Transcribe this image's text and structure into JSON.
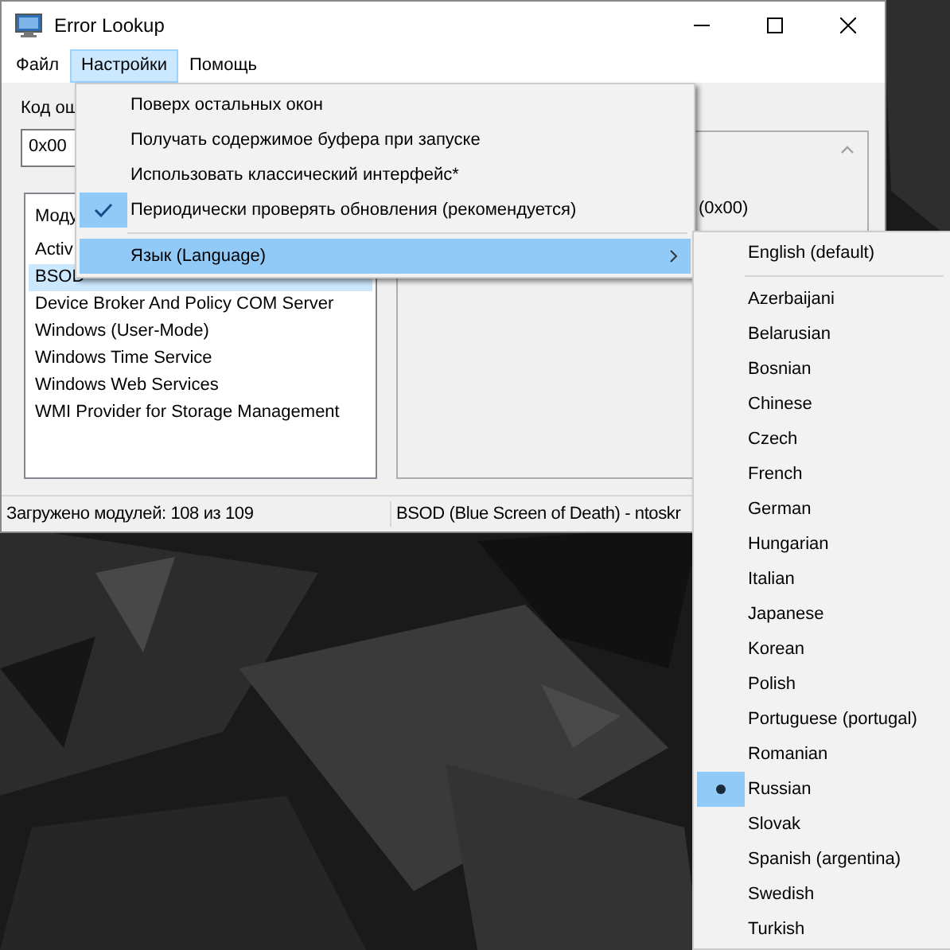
{
  "window": {
    "title": "Error Lookup"
  },
  "menu_bar": [
    {
      "label": "Файл",
      "selected": false
    },
    {
      "label": "Настройки",
      "selected": true
    },
    {
      "label": "Помощь",
      "selected": false
    }
  ],
  "error_code": {
    "label": "Код ош",
    "value": "0x00"
  },
  "modules": {
    "header": "Моду",
    "items": [
      {
        "label": "Activ",
        "selected": false
      },
      {
        "label": "BSOD",
        "selected": true
      },
      {
        "label": "Device Broker And Policy COM Server",
        "selected": false
      },
      {
        "label": "Windows (User-Mode)",
        "selected": false
      },
      {
        "label": "Windows Time Service",
        "selected": false
      },
      {
        "label": "Windows Web Services",
        "selected": false
      },
      {
        "label": "WMI Provider for Storage Management",
        "selected": false
      }
    ]
  },
  "details": {
    "text": "(0x00)"
  },
  "status_bar": [
    "Загружено модулей: 108 из 109",
    "BSOD (Blue Screen of Death) - ntoskr"
  ],
  "settings_menu": {
    "items": [
      {
        "kind": "check",
        "label": "Поверх остальных окон",
        "checked": false
      },
      {
        "kind": "check",
        "label": "Получать содержимое буфера при запуске",
        "checked": false
      },
      {
        "kind": "check",
        "label": "Использовать классический интерфейс*",
        "checked": false
      },
      {
        "kind": "check",
        "label": "Периодически проверять обновления (рекомендуется)",
        "checked": true
      },
      {
        "kind": "separator"
      },
      {
        "kind": "submenu",
        "label": "Язык (Language)",
        "selected": true
      }
    ]
  },
  "language_menu": {
    "items": [
      {
        "kind": "radio",
        "label": "English (default)",
        "checked": false
      },
      {
        "kind": "separator"
      },
      {
        "kind": "radio",
        "label": "Azerbaijani",
        "checked": false
      },
      {
        "kind": "radio",
        "label": "Belarusian",
        "checked": false
      },
      {
        "kind": "radio",
        "label": "Bosnian",
        "checked": false
      },
      {
        "kind": "radio",
        "label": "Chinese",
        "checked": false
      },
      {
        "kind": "radio",
        "label": "Czech",
        "checked": false
      },
      {
        "kind": "radio",
        "label": "French",
        "checked": false
      },
      {
        "kind": "radio",
        "label": "German",
        "checked": false
      },
      {
        "kind": "radio",
        "label": "Hungarian",
        "checked": false
      },
      {
        "kind": "radio",
        "label": "Italian",
        "checked": false
      },
      {
        "kind": "radio",
        "label": "Japanese",
        "checked": false
      },
      {
        "kind": "radio",
        "label": "Korean",
        "checked": false
      },
      {
        "kind": "radio",
        "label": "Polish",
        "checked": false
      },
      {
        "kind": "radio",
        "label": "Portuguese (portugal)",
        "checked": false
      },
      {
        "kind": "radio",
        "label": "Romanian",
        "checked": false
      },
      {
        "kind": "radio",
        "label": "Russian",
        "checked": true
      },
      {
        "kind": "radio",
        "label": "Slovak",
        "checked": false
      },
      {
        "kind": "radio",
        "label": "Spanish (argentina)",
        "checked": false
      },
      {
        "kind": "radio",
        "label": "Swedish",
        "checked": false
      },
      {
        "kind": "radio",
        "label": "Turkish",
        "checked": false
      }
    ]
  }
}
